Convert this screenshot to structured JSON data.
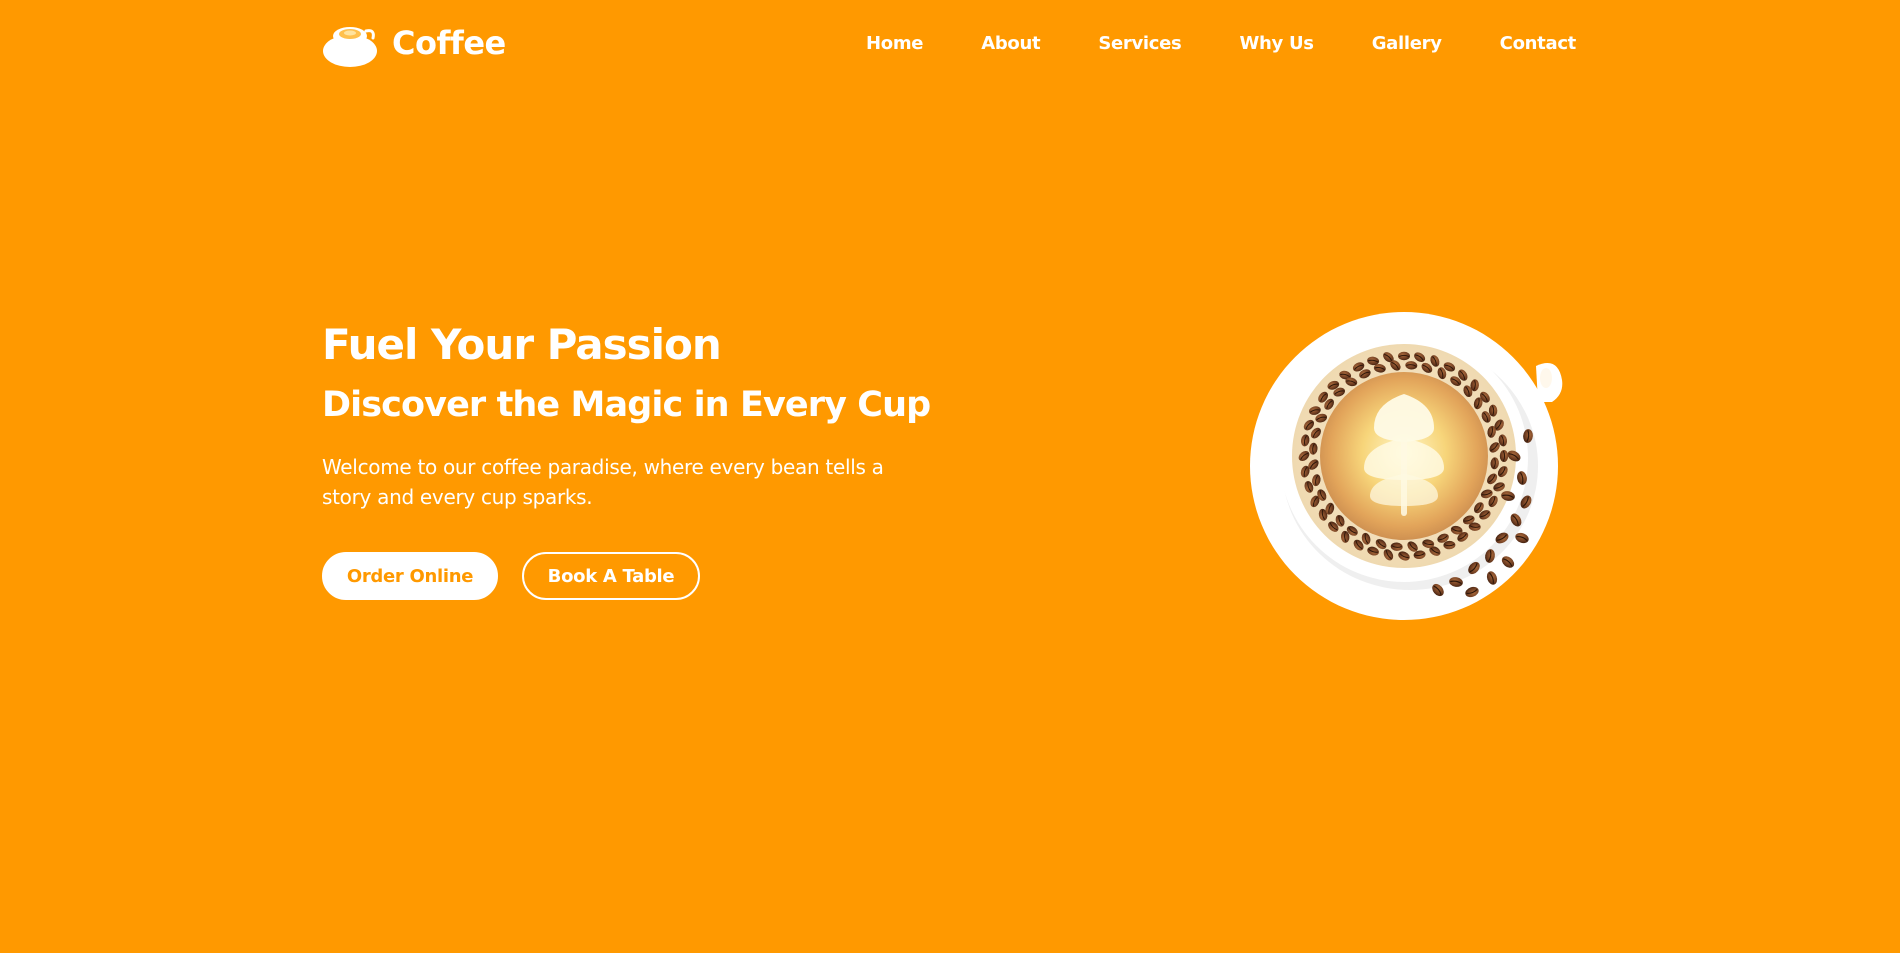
{
  "brand": {
    "name": "Coffee",
    "logo_icon": "coffee-cup-logo-icon"
  },
  "nav": {
    "items": [
      {
        "label": "Home"
      },
      {
        "label": "About"
      },
      {
        "label": "Services"
      },
      {
        "label": "Why Us"
      },
      {
        "label": "Gallery"
      },
      {
        "label": "Contact"
      }
    ]
  },
  "hero": {
    "title": "Fuel Your Passion",
    "subtitle": "Discover the Magic in Every Cup",
    "description": "Welcome to our coffee paradise, where every bean tells a story and every cup sparks.",
    "primary_button": "Order Online",
    "secondary_button": "Book A Table",
    "image_icon": "latte-cup-with-coffee-beans"
  },
  "colors": {
    "background": "#FF9900",
    "text": "#FFFFFF",
    "accent": "#FF9900",
    "bean": "#6B3A1F"
  }
}
